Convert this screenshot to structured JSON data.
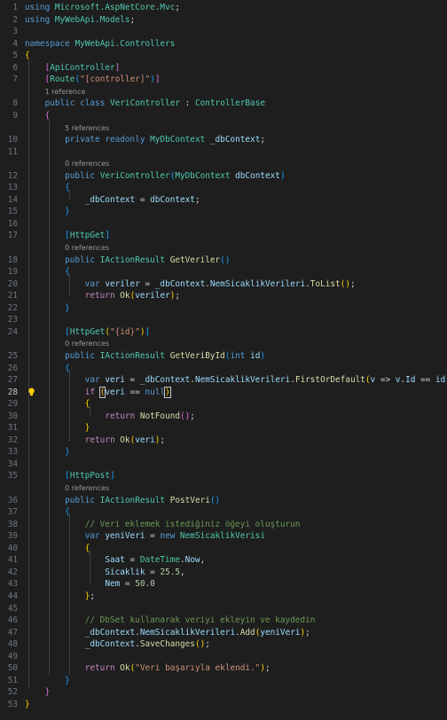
{
  "editor": {
    "language": "C#",
    "theme_background": "#1e1e1e",
    "rows": [
      {
        "ln": "1",
        "tokens": [
          [
            "kw",
            "using"
          ],
          [
            "pl",
            " "
          ],
          [
            "ty",
            "Microsoft.AspNetCore.Mvc"
          ],
          [
            "pl",
            ";"
          ]
        ]
      },
      {
        "ln": "2",
        "tokens": [
          [
            "kw",
            "using"
          ],
          [
            "pl",
            " "
          ],
          [
            "ty",
            "MyWebApi.Models"
          ],
          [
            "pl",
            ";"
          ]
        ]
      },
      {
        "ln": "3",
        "tokens": []
      },
      {
        "ln": "4",
        "tokens": [
          [
            "kw",
            "namespace"
          ],
          [
            "pl",
            " "
          ],
          [
            "ty",
            "MyWebApi.Controllers"
          ]
        ]
      },
      {
        "ln": "5",
        "tokens": [
          [
            "br1",
            "{"
          ]
        ]
      },
      {
        "ln": "6",
        "tokens": [
          [
            "pl",
            "    "
          ],
          [
            "br2",
            "["
          ],
          [
            "ty",
            "ApiController"
          ],
          [
            "br2",
            "]"
          ]
        ]
      },
      {
        "ln": "7",
        "tokens": [
          [
            "pl",
            "    "
          ],
          [
            "br2",
            "["
          ],
          [
            "ty",
            "Route"
          ],
          [
            "br3",
            "("
          ],
          [
            "st",
            "\"[controller]\""
          ],
          [
            "br3",
            ")"
          ],
          [
            "br2",
            "]"
          ]
        ]
      },
      {
        "ln": "",
        "lens": "1 reference",
        "indent": "    "
      },
      {
        "ln": "8",
        "tokens": [
          [
            "pl",
            "    "
          ],
          [
            "kw",
            "public"
          ],
          [
            "pl",
            " "
          ],
          [
            "kw",
            "class"
          ],
          [
            "pl",
            " "
          ],
          [
            "ty",
            "VeriController"
          ],
          [
            "pl",
            " : "
          ],
          [
            "ty",
            "ControllerBase"
          ]
        ]
      },
      {
        "ln": "9",
        "tokens": [
          [
            "pl",
            "    "
          ],
          [
            "br2",
            "{"
          ]
        ]
      },
      {
        "ln": "",
        "lens": "5 references",
        "indent": "        "
      },
      {
        "ln": "10",
        "tokens": [
          [
            "pl",
            "        "
          ],
          [
            "kw",
            "private"
          ],
          [
            "pl",
            " "
          ],
          [
            "kw",
            "readonly"
          ],
          [
            "pl",
            " "
          ],
          [
            "ty",
            "MyDbContext"
          ],
          [
            "pl",
            " "
          ],
          [
            "vr",
            "_dbContext"
          ],
          [
            "pl",
            ";"
          ]
        ]
      },
      {
        "ln": "11",
        "tokens": []
      },
      {
        "ln": "",
        "lens": "0 references",
        "indent": "        "
      },
      {
        "ln": "12",
        "tokens": [
          [
            "pl",
            "        "
          ],
          [
            "kw",
            "public"
          ],
          [
            "pl",
            " "
          ],
          [
            "ty",
            "VeriController"
          ],
          [
            "br3",
            "("
          ],
          [
            "ty",
            "MyDbContext"
          ],
          [
            "pl",
            " "
          ],
          [
            "vr",
            "dbContext"
          ],
          [
            "br3",
            ")"
          ]
        ]
      },
      {
        "ln": "13",
        "tokens": [
          [
            "pl",
            "        "
          ],
          [
            "br3",
            "{"
          ]
        ]
      },
      {
        "ln": "14",
        "tokens": [
          [
            "pl",
            "            "
          ],
          [
            "vr",
            "_dbContext"
          ],
          [
            "pl",
            " = "
          ],
          [
            "vr",
            "dbContext"
          ],
          [
            "pl",
            ";"
          ]
        ]
      },
      {
        "ln": "15",
        "tokens": [
          [
            "pl",
            "        "
          ],
          [
            "br3",
            "}"
          ]
        ]
      },
      {
        "ln": "16",
        "tokens": []
      },
      {
        "ln": "17",
        "tokens": [
          [
            "pl",
            "        "
          ],
          [
            "br3",
            "["
          ],
          [
            "ty",
            "HttpGet"
          ],
          [
            "br3",
            "]"
          ]
        ]
      },
      {
        "ln": "",
        "lens": "0 references",
        "indent": "        "
      },
      {
        "ln": "18",
        "tokens": [
          [
            "pl",
            "        "
          ],
          [
            "kw",
            "public"
          ],
          [
            "pl",
            " "
          ],
          [
            "ty",
            "IActionResult"
          ],
          [
            "pl",
            " "
          ],
          [
            "fn",
            "GetVeriler"
          ],
          [
            "br3",
            "()"
          ]
        ]
      },
      {
        "ln": "19",
        "tokens": [
          [
            "pl",
            "        "
          ],
          [
            "br3",
            "{"
          ]
        ]
      },
      {
        "ln": "20",
        "tokens": [
          [
            "pl",
            "            "
          ],
          [
            "kw",
            "var"
          ],
          [
            "pl",
            " "
          ],
          [
            "vr",
            "veriler"
          ],
          [
            "pl",
            " = "
          ],
          [
            "vr",
            "_dbContext"
          ],
          [
            "pl",
            "."
          ],
          [
            "vr",
            "NemSicaklikVerileri"
          ],
          [
            "pl",
            "."
          ],
          [
            "fn",
            "ToList"
          ],
          [
            "br1",
            "()"
          ],
          [
            "pl",
            ";"
          ]
        ]
      },
      {
        "ln": "21",
        "tokens": [
          [
            "pl",
            "            "
          ],
          [
            "ctl",
            "return"
          ],
          [
            "pl",
            " "
          ],
          [
            "fn",
            "Ok"
          ],
          [
            "br1",
            "("
          ],
          [
            "vr",
            "veriler"
          ],
          [
            "br1",
            ")"
          ],
          [
            "pl",
            ";"
          ]
        ]
      },
      {
        "ln": "22",
        "tokens": [
          [
            "pl",
            "        "
          ],
          [
            "br3",
            "}"
          ]
        ]
      },
      {
        "ln": "23",
        "tokens": []
      },
      {
        "ln": "24",
        "tokens": [
          [
            "pl",
            "        "
          ],
          [
            "br3",
            "["
          ],
          [
            "ty",
            "HttpGet"
          ],
          [
            "br1",
            "("
          ],
          [
            "st",
            "\"{id}\""
          ],
          [
            "br1",
            ")"
          ],
          [
            "br3",
            "]"
          ]
        ]
      },
      {
        "ln": "",
        "lens": "0 references",
        "indent": "        "
      },
      {
        "ln": "25",
        "tokens": [
          [
            "pl",
            "        "
          ],
          [
            "kw",
            "public"
          ],
          [
            "pl",
            " "
          ],
          [
            "ty",
            "IActionResult"
          ],
          [
            "pl",
            " "
          ],
          [
            "fn",
            "GetVeriById"
          ],
          [
            "br3",
            "("
          ],
          [
            "kw",
            "int"
          ],
          [
            "pl",
            " "
          ],
          [
            "vr",
            "id"
          ],
          [
            "br3",
            ")"
          ]
        ]
      },
      {
        "ln": "26",
        "tokens": [
          [
            "pl",
            "        "
          ],
          [
            "br3",
            "{"
          ]
        ]
      },
      {
        "ln": "27",
        "tokens": [
          [
            "pl",
            "            "
          ],
          [
            "kw",
            "var"
          ],
          [
            "pl",
            " "
          ],
          [
            "vr",
            "veri"
          ],
          [
            "pl",
            " = "
          ],
          [
            "vr",
            "_dbContext"
          ],
          [
            "pl",
            "."
          ],
          [
            "vr",
            "NemSicaklikVerileri"
          ],
          [
            "pl",
            "."
          ],
          [
            "fn",
            "FirstOrDefault"
          ],
          [
            "br1",
            "("
          ],
          [
            "vr",
            "v"
          ],
          [
            "pl",
            " => "
          ],
          [
            "vr",
            "v"
          ],
          [
            "pl",
            "."
          ],
          [
            "vr",
            "Id"
          ],
          [
            "pl",
            " == "
          ],
          [
            "vr",
            "id"
          ],
          [
            "br1",
            ")"
          ],
          [
            "pl",
            ";"
          ]
        ]
      },
      {
        "ln": "28",
        "active": true,
        "bulb": true,
        "tokens": [
          [
            "pl",
            "            "
          ],
          [
            "ctl",
            "if"
          ],
          [
            "pl",
            " "
          ],
          [
            "br1box",
            "("
          ],
          [
            "vr",
            "veri"
          ],
          [
            "pl",
            " == "
          ],
          [
            "kw",
            "null"
          ],
          [
            "br1box",
            ")"
          ]
        ]
      },
      {
        "ln": "29",
        "tokens": [
          [
            "pl",
            "            "
          ],
          [
            "br1",
            "{"
          ]
        ]
      },
      {
        "ln": "30",
        "tokens": [
          [
            "pl",
            "                "
          ],
          [
            "ctl",
            "return"
          ],
          [
            "pl",
            " "
          ],
          [
            "fn",
            "NotFound"
          ],
          [
            "br2",
            "()"
          ],
          [
            "pl",
            ";"
          ]
        ]
      },
      {
        "ln": "31",
        "tokens": [
          [
            "pl",
            "            "
          ],
          [
            "br1",
            "}"
          ]
        ]
      },
      {
        "ln": "32",
        "tokens": [
          [
            "pl",
            "            "
          ],
          [
            "ctl",
            "return"
          ],
          [
            "pl",
            " "
          ],
          [
            "fn",
            "Ok"
          ],
          [
            "br1",
            "("
          ],
          [
            "vr",
            "veri"
          ],
          [
            "br1",
            ")"
          ],
          [
            "pl",
            ";"
          ]
        ]
      },
      {
        "ln": "33",
        "tokens": [
          [
            "pl",
            "        "
          ],
          [
            "br3",
            "}"
          ]
        ]
      },
      {
        "ln": "34",
        "tokens": []
      },
      {
        "ln": "35",
        "tokens": [
          [
            "pl",
            "        "
          ],
          [
            "br3",
            "["
          ],
          [
            "ty",
            "HttpPost"
          ],
          [
            "br3",
            "]"
          ]
        ]
      },
      {
        "ln": "",
        "lens": "0 references",
        "indent": "        "
      },
      {
        "ln": "36",
        "tokens": [
          [
            "pl",
            "        "
          ],
          [
            "kw",
            "public"
          ],
          [
            "pl",
            " "
          ],
          [
            "ty",
            "IActionResult"
          ],
          [
            "pl",
            " "
          ],
          [
            "fn",
            "PostVeri"
          ],
          [
            "br3",
            "()"
          ]
        ]
      },
      {
        "ln": "37",
        "tokens": [
          [
            "pl",
            "        "
          ],
          [
            "br3",
            "{"
          ]
        ]
      },
      {
        "ln": "38",
        "tokens": [
          [
            "pl",
            "            "
          ],
          [
            "cm",
            "// Veri eklemek istediğiniz öğeyi oluşturun"
          ]
        ]
      },
      {
        "ln": "39",
        "tokens": [
          [
            "pl",
            "            "
          ],
          [
            "kw",
            "var"
          ],
          [
            "pl",
            " "
          ],
          [
            "vr",
            "yeniVeri"
          ],
          [
            "pl",
            " = "
          ],
          [
            "kw",
            "new"
          ],
          [
            "pl",
            " "
          ],
          [
            "ty",
            "NemSicaklikVerisi"
          ]
        ]
      },
      {
        "ln": "40",
        "tokens": [
          [
            "pl",
            "            "
          ],
          [
            "br1",
            "{"
          ]
        ]
      },
      {
        "ln": "41",
        "tokens": [
          [
            "pl",
            "                "
          ],
          [
            "vr",
            "Saat"
          ],
          [
            "pl",
            " = "
          ],
          [
            "ty",
            "DateTime"
          ],
          [
            "pl",
            "."
          ],
          [
            "vr",
            "Now"
          ],
          [
            "pl",
            ","
          ]
        ]
      },
      {
        "ln": "42",
        "tokens": [
          [
            "pl",
            "                "
          ],
          [
            "vr",
            "Sicaklik"
          ],
          [
            "pl",
            " = "
          ],
          [
            "nm",
            "25.5"
          ],
          [
            "pl",
            ","
          ]
        ]
      },
      {
        "ln": "43",
        "tokens": [
          [
            "pl",
            "                "
          ],
          [
            "vr",
            "Nem"
          ],
          [
            "pl",
            " = "
          ],
          [
            "nm",
            "50.0"
          ]
        ]
      },
      {
        "ln": "44",
        "tokens": [
          [
            "pl",
            "            "
          ],
          [
            "br1",
            "}"
          ],
          [
            "pl",
            ";"
          ]
        ]
      },
      {
        "ln": "45",
        "tokens": []
      },
      {
        "ln": "46",
        "tokens": [
          [
            "pl",
            "            "
          ],
          [
            "cm",
            "// DbSet kullanarak veriyi ekleyin ve kaydedin"
          ]
        ]
      },
      {
        "ln": "47",
        "tokens": [
          [
            "pl",
            "            "
          ],
          [
            "vr",
            "_dbContext"
          ],
          [
            "pl",
            "."
          ],
          [
            "vr",
            "NemSicaklikVerileri"
          ],
          [
            "pl",
            "."
          ],
          [
            "fn",
            "Add"
          ],
          [
            "br1",
            "("
          ],
          [
            "vr",
            "yeniVeri"
          ],
          [
            "br1",
            ")"
          ],
          [
            "pl",
            ";"
          ]
        ]
      },
      {
        "ln": "48",
        "tokens": [
          [
            "pl",
            "            "
          ],
          [
            "vr",
            "_dbContext"
          ],
          [
            "pl",
            "."
          ],
          [
            "fn",
            "SaveChanges"
          ],
          [
            "br1",
            "()"
          ],
          [
            "pl",
            ";"
          ]
        ]
      },
      {
        "ln": "49",
        "tokens": []
      },
      {
        "ln": "50",
        "tokens": [
          [
            "pl",
            "            "
          ],
          [
            "ctl",
            "return"
          ],
          [
            "pl",
            " "
          ],
          [
            "fn",
            "Ok"
          ],
          [
            "br1",
            "("
          ],
          [
            "st",
            "\"Veri başarıyla eklendi.\""
          ],
          [
            "br1",
            ")"
          ],
          [
            "pl",
            ";"
          ]
        ]
      },
      {
        "ln": "51",
        "tokens": [
          [
            "pl",
            "        "
          ],
          [
            "br3",
            "}"
          ]
        ]
      },
      {
        "ln": "52",
        "tokens": [
          [
            "pl",
            "    "
          ],
          [
            "br2",
            "}"
          ]
        ]
      },
      {
        "ln": "53",
        "tokens": [
          [
            "br1",
            "}"
          ]
        ]
      }
    ]
  }
}
